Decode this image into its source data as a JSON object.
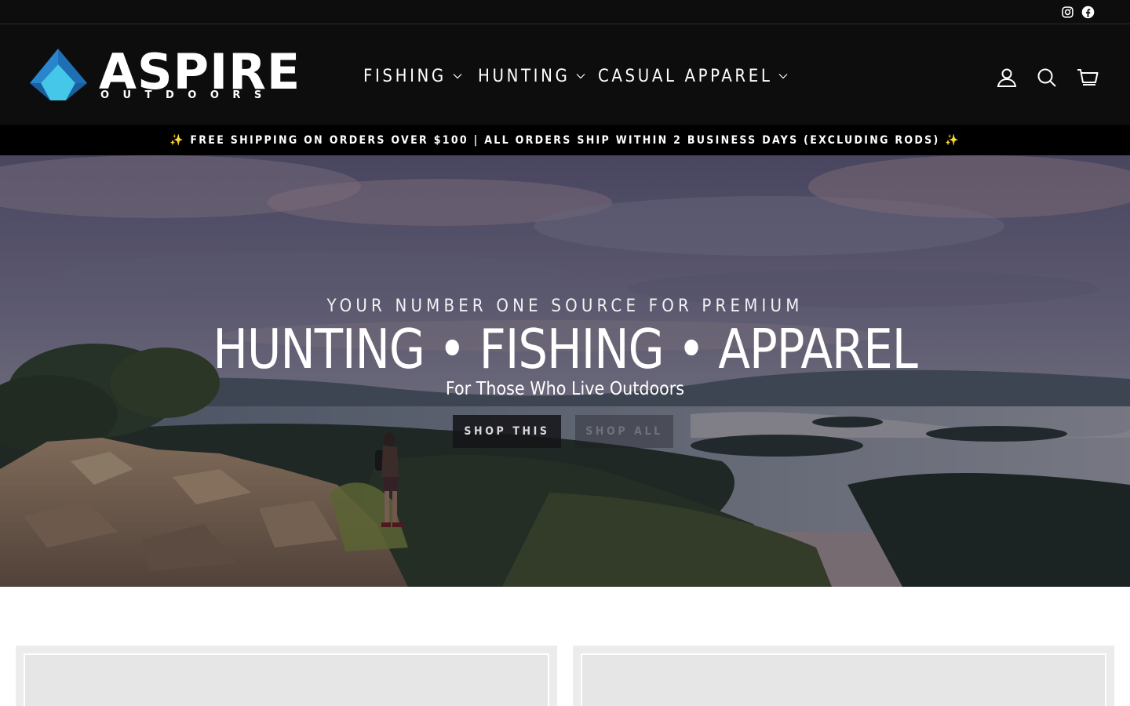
{
  "social": [
    {
      "name": "Instagram",
      "icon": "instagram-icon"
    },
    {
      "name": "Facebook",
      "icon": "facebook-icon"
    }
  ],
  "logo": {
    "brand": "ASPIRE",
    "tagline": "OUTDOORS"
  },
  "nav": [
    {
      "label": "FISHING",
      "icon": "chevron-down-icon"
    },
    {
      "label": "HUNTING",
      "icon": "chevron-down-icon"
    },
    {
      "label": "CASUAL APPAREL",
      "icon": "chevron-down-icon"
    }
  ],
  "header_icons": [
    {
      "label": "Log in",
      "icon": "user-icon"
    },
    {
      "label": "Search",
      "icon": "search-icon"
    },
    {
      "label": "Cart",
      "icon": "cart-icon"
    }
  ],
  "announcement": "✨ FREE SHIPPING ON ORDERS OVER $100 | ALL ORDERS SHIP WITHIN 2 BUSINESS DAYS (EXCLUDING RODS) ✨",
  "hero": {
    "kicker": "YOUR NUMBER ONE SOURCE FOR PREMIUM",
    "headline": "HUNTING • FISHING • APPAREL",
    "subheading": "For Those Who Live Outdoors",
    "primary_button": "SHOP THIS",
    "secondary_button": "SHOP ALL"
  },
  "colors": {
    "header_bg": "#0d0d0d",
    "announcement_bg": "#000000",
    "logo_blue_dark": "#1f6fb4",
    "logo_blue_light": "#44c7e8",
    "card_bg": "#ececec"
  }
}
